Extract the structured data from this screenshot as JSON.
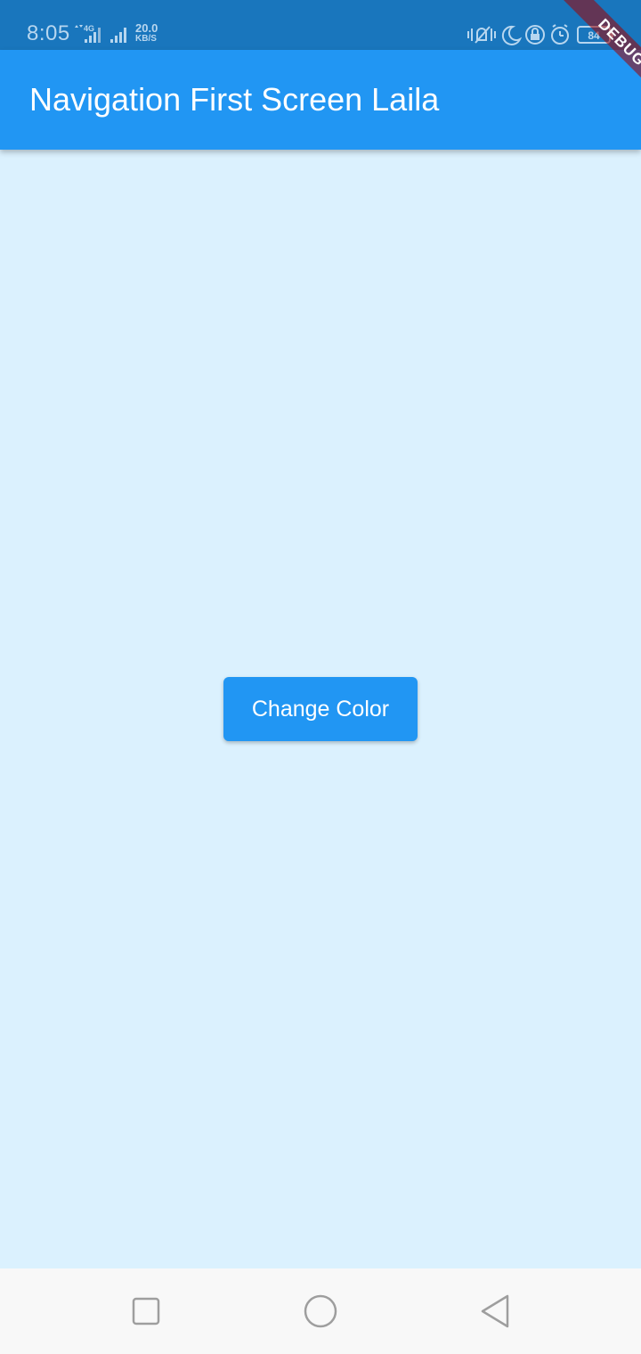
{
  "status_bar": {
    "time": "8:05",
    "net_type": "4G",
    "speed_value": "20.0",
    "speed_unit": "KB/S",
    "battery": "84",
    "icons": [
      "signal-4g-icon",
      "signal-icon",
      "vibrate-icon",
      "moon-icon",
      "rotation-lock-icon",
      "alarm-icon",
      "battery-icon"
    ],
    "background_color": "#1976bd"
  },
  "app_bar": {
    "title": "Navigation First Screen Laila",
    "background_color": "#2196f3"
  },
  "debug_banner": {
    "label": "DEBUG"
  },
  "main": {
    "background_color": "#dbf1fe",
    "button_label": "Change Color",
    "button_color": "#2196f3"
  },
  "nav_bar": {
    "icons": [
      "recents-square-icon",
      "home-circle-icon",
      "back-triangle-icon"
    ]
  }
}
